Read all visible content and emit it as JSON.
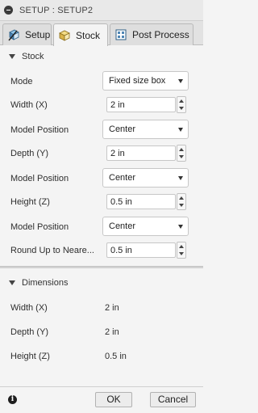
{
  "window": {
    "title": "SETUP : SETUP2",
    "icon": "minus-circle-icon"
  },
  "tabs": [
    {
      "label": "Setup",
      "icon": "setup-icon",
      "active": false
    },
    {
      "label": "Stock",
      "icon": "stock-icon",
      "active": true
    },
    {
      "label": "Post Process",
      "icon": "post-process-icon",
      "active": false
    }
  ],
  "stock": {
    "title": "Stock",
    "mode": {
      "label": "Mode",
      "value": "Fixed size box"
    },
    "width": {
      "label": "Width (X)",
      "value": "2 in"
    },
    "width_position": {
      "label": "Model Position",
      "value": "Center"
    },
    "depth": {
      "label": "Depth (Y)",
      "value": "2 in"
    },
    "depth_position": {
      "label": "Model Position",
      "value": "Center"
    },
    "height": {
      "label": "Height (Z)",
      "value": "0.5 in"
    },
    "height_position": {
      "label": "Model Position",
      "value": "Center"
    },
    "round_up": {
      "label": "Round Up to Neare...",
      "value": "0.5 in"
    }
  },
  "dimensions": {
    "title": "Dimensions",
    "width": {
      "label": "Width (X)",
      "value": "2 in"
    },
    "depth": {
      "label": "Depth (Y)",
      "value": "2 in"
    },
    "height": {
      "label": "Height (Z)",
      "value": "0.5 in"
    }
  },
  "footer": {
    "ok_label": "OK",
    "cancel_label": "Cancel",
    "info_icon": "info-icon"
  }
}
